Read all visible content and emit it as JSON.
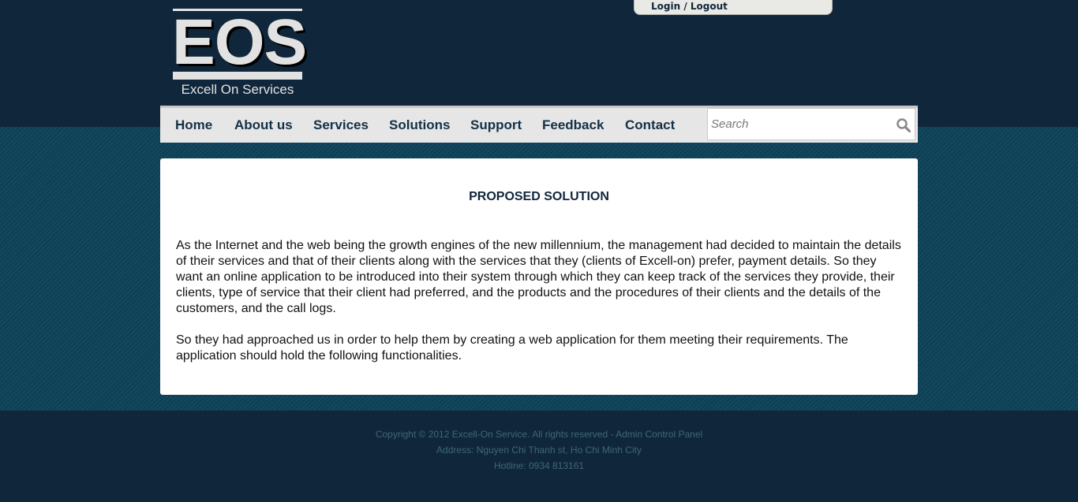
{
  "logo": {
    "letters": "EOS",
    "tagline": "Excell On Services"
  },
  "auth": {
    "login_logout": "Login / Logout"
  },
  "nav": {
    "items": [
      "Home",
      "About us",
      "Services",
      "Solutions",
      "Support",
      "Feedback",
      "Contact"
    ]
  },
  "search": {
    "placeholder": "Search"
  },
  "content": {
    "title": "PROPOSED SOLUTION",
    "paragraphs": [
      "As the Internet and the web being the growth engines of the new millennium, the management had decided to maintain the details of their services and that of their clients along with the services that they (clients of Excell-on) prefer, payment details. So they want an online application to be introduced into their system through which they can keep track of the services they provide, their clients, type of service that their client had preferred, and the products and the procedures of their clients and the details of the customers, and the call logs.",
      "So they had approached us in order to help them by creating a web application for them meeting their requirements. The application should hold the following functionalities."
    ]
  },
  "footer": {
    "copyright": "Copyright © 2012 Excell-On Service. All rights reserved - Admin Control Panel",
    "address": "Address: Nguyen Chi Thanh st, Ho Chi Minh City",
    "hotline": "Hotline: 0934 813161"
  }
}
